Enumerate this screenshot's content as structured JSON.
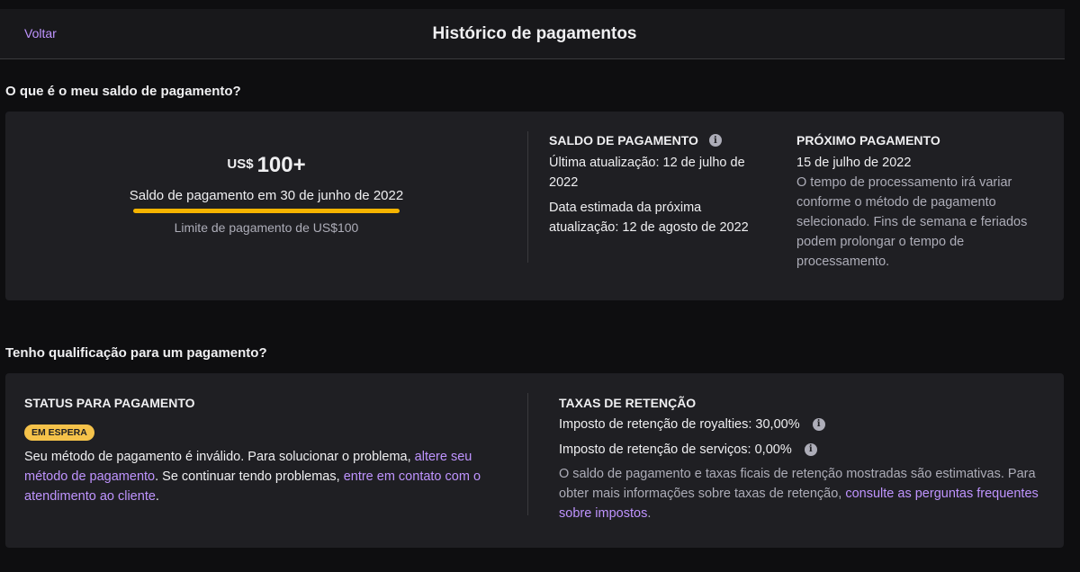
{
  "header": {
    "back_label": "Voltar",
    "title": "Histórico de pagamentos"
  },
  "balance_section": {
    "heading": "O que é o meu saldo de pagamento?",
    "currency": "US$",
    "amount": "100+",
    "caption": "Saldo de pagamento em 30 de junho de 2022",
    "progress_fraction": 1.0,
    "limit": "Limite de pagamento de US$100",
    "payout_balance": {
      "title": "SALDO DE PAGAMENTO",
      "last_update": "Última atualização: 12 de julho de 2022",
      "next_update": "Data estimada da próxima atualização: 12 de agosto de 2022"
    },
    "next_payout": {
      "title": "PRÓXIMO PAGAMENTO",
      "date": "15 de julho de 2022",
      "note": "O tempo de processamento irá variar conforme o método de pagamento selecionado. Fins de semana e feriados podem prolongar o tempo de processamento."
    }
  },
  "eligibility_section": {
    "heading": "Tenho qualificação para um pagamento?",
    "status": {
      "title": "STATUS PARA PAGAMENTO",
      "badge": "EM ESPERA",
      "text_1": "Seu método de pagamento é inválido. Para solucionar o problema, ",
      "link_1": "altere seu método de pagamento",
      "text_2": ". Se continuar tendo problemas, ",
      "link_2": "entre em contato com o atendimento ao cliente",
      "text_3": "."
    },
    "withholding": {
      "title": "TAXAS DE RETENÇÃO",
      "royalty": "Imposto de retenção de royalties: 30,00%",
      "services": "Imposto de retenção de serviços: 0,00%",
      "note_text": "O saldo de pagamento e taxas ficais de retenção mostradas são estimativas. Para obter mais informações sobre taxas de retenção, ",
      "note_link": "consulte as perguntas frequentes sobre impostos",
      "note_end": "."
    }
  },
  "colors": {
    "background": "#0e0e10",
    "card": "#1f1f23",
    "accent_link": "#bf94ff",
    "progress": "#f5b400",
    "badge": "#f5c24a"
  },
  "icons": [
    "info-icon"
  ]
}
